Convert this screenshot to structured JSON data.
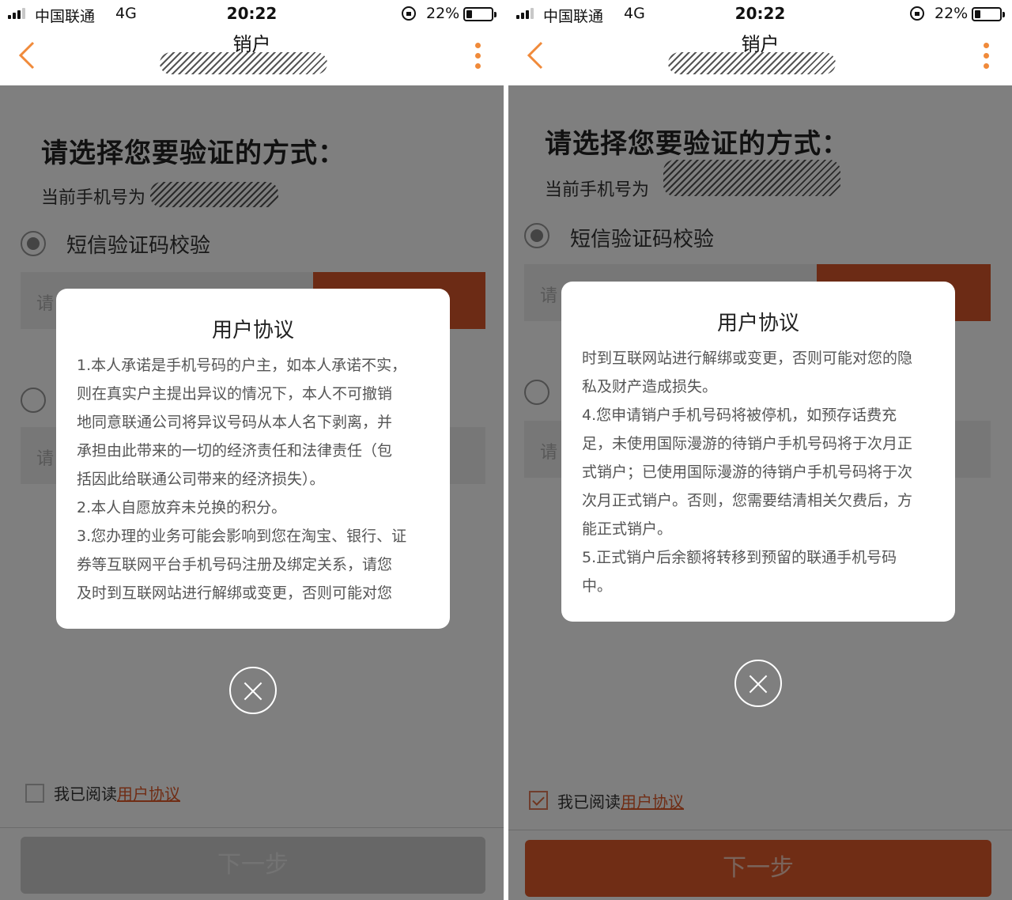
{
  "status_bar": {
    "carrier": "中国联通",
    "network": "4G",
    "time": "20:22",
    "battery": "22%",
    "battery_level": 0.22
  },
  "header": {
    "title": "销户"
  },
  "page": {
    "heading": "请选择您要验证的方式：",
    "phone_label": "当前手机号为",
    "option1_label": "短信验证码校验",
    "input_placeholder_fragment": "请"
  },
  "modal": {
    "title": "用户协议"
  },
  "left_modal_lines": [
    "1.本人承诺是手机号码的户主，如本人承诺不实，",
    "则在真实户主提出异议的情况下，本人不可撤销",
    "地同意联通公司将异议号码从本人名下剥离，并",
    "承担由此带来的一切的经济责任和法律责任（包",
    "括因此给联通公司带来的经济损失）。",
    "2.本人自愿放弃未兑换的积分。",
    "3.您办理的业务可能会影响到您在淘宝、银行、证",
    "券等互联网平台手机号码注册及绑定关系，请您",
    "及时到互联网站进行解绑或变更，否则可能对您"
  ],
  "right_modal_lines": [
    "时到互联网站进行解绑或变更，否则可能对您的隐",
    "私及财产造成损失。",
    "4.您申请销户手机号码将被停机，如预存话费充",
    "足，未使用国际漫游的待销户手机号码将于次月正",
    "式销户；已使用国际漫游的待销户手机号码将于次",
    "次月正式销户。否则，您需要结清相关欠费后，方",
    "能正式销户。",
    "5.正式销户后余额将转移到预留的联通手机号码",
    "中。"
  ],
  "footer": {
    "agree_prefix": "我已阅读",
    "agree_link": "用户协议",
    "next_button": "下一步",
    "left_agree_checked": false,
    "right_agree_checked": true
  },
  "colors": {
    "accent": "#e05a2a",
    "back_arrow": "#f08a3a"
  }
}
